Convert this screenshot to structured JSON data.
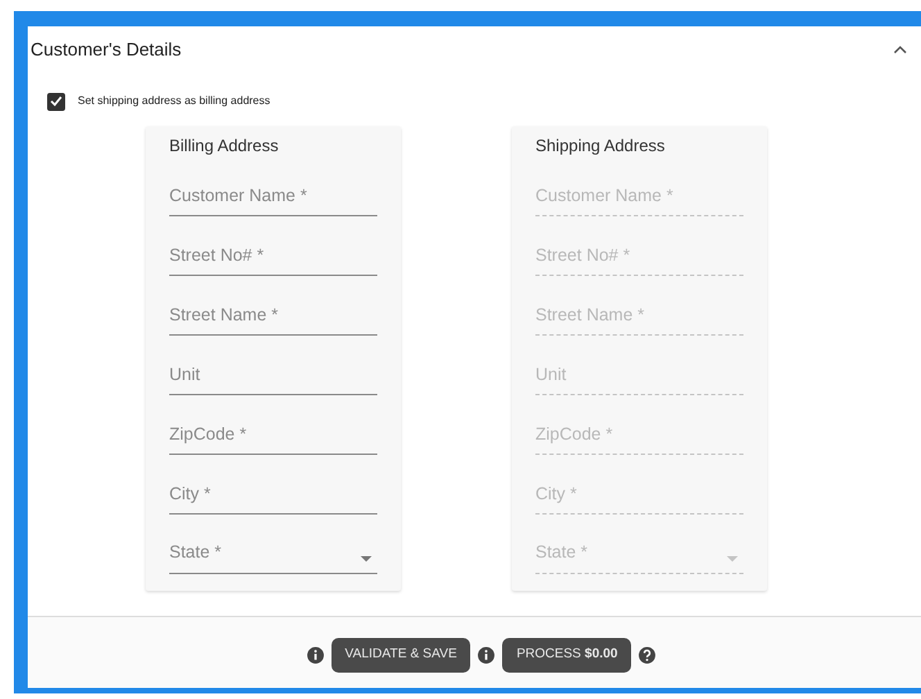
{
  "panel": {
    "title": "Customer's Details",
    "expanded": true
  },
  "same_address": {
    "label": "Set shipping address as billing address",
    "checked": true
  },
  "addresses": [
    {
      "title": "Billing Address",
      "disabled": false,
      "fields": [
        {
          "kind": "text",
          "placeholder": "Customer Name *"
        },
        {
          "kind": "text",
          "placeholder": "Street No# *"
        },
        {
          "kind": "text",
          "placeholder": "Street Name *"
        },
        {
          "kind": "text",
          "placeholder": "Unit"
        },
        {
          "kind": "text",
          "placeholder": "ZipCode *"
        },
        {
          "kind": "text",
          "placeholder": "City *"
        },
        {
          "kind": "select",
          "placeholder": "State *"
        }
      ]
    },
    {
      "title": "Shipping Address",
      "disabled": true,
      "fields": [
        {
          "kind": "text",
          "placeholder": "Customer Name *"
        },
        {
          "kind": "text",
          "placeholder": "Street No# *"
        },
        {
          "kind": "text",
          "placeholder": "Street Name *"
        },
        {
          "kind": "text",
          "placeholder": "Unit"
        },
        {
          "kind": "text",
          "placeholder": "ZipCode *"
        },
        {
          "kind": "text",
          "placeholder": "City *"
        },
        {
          "kind": "select",
          "placeholder": "State *"
        }
      ]
    }
  ],
  "actions": [
    {
      "kind": "info-button",
      "label": "VALIDATE & SAVE"
    },
    {
      "kind": "info-button",
      "label": "PROCESS **$0.00**"
    },
    {
      "kind": "help"
    }
  ]
}
